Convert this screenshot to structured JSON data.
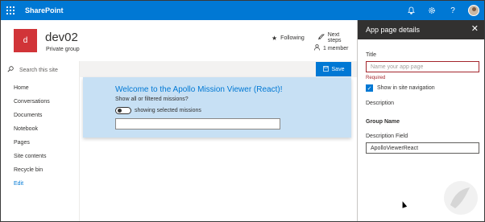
{
  "suitebar": {
    "brand": "SharePoint",
    "icons": [
      "waffle-icon",
      "bell-icon",
      "gear-icon",
      "help-icon",
      "avatar"
    ],
    "help": "?"
  },
  "site": {
    "logo_letter": "d",
    "title": "dev02",
    "subtitle": "Private group",
    "following": "Following",
    "next_steps": "Next steps",
    "members": "1 member"
  },
  "leftnav": {
    "search_placeholder": "Search this site",
    "items": [
      {
        "label": "Home"
      },
      {
        "label": "Conversations"
      },
      {
        "label": "Documents"
      },
      {
        "label": "Notebook"
      },
      {
        "label": "Pages"
      },
      {
        "label": "Site contents"
      },
      {
        "label": "Recycle bin"
      },
      {
        "label": "Edit"
      }
    ]
  },
  "commandbar": {
    "save_label": "Save"
  },
  "webpart": {
    "title": "Welcome to the Apollo Mission Viewer (React)!",
    "question": "Show all or filtered missions?",
    "toggle_label": "showing selected missions",
    "toggle_on": false,
    "input_value": ""
  },
  "panel": {
    "title": "App page details",
    "title_label": "Title",
    "title_placeholder": "Name your app page",
    "required": "Required",
    "show_in_nav": "Show in site navigation",
    "show_in_nav_checked": true,
    "description_label": "Description",
    "group_name": "Group Name",
    "description_field_label": "Description Field",
    "description_field_value": "ApolloViewerReact"
  },
  "colors": {
    "suitebar": "#0078d4",
    "site_logo": "#d13438",
    "webpart_bg": "#c7e0f4",
    "panel_header": "#323130",
    "error": "#a4262c"
  }
}
